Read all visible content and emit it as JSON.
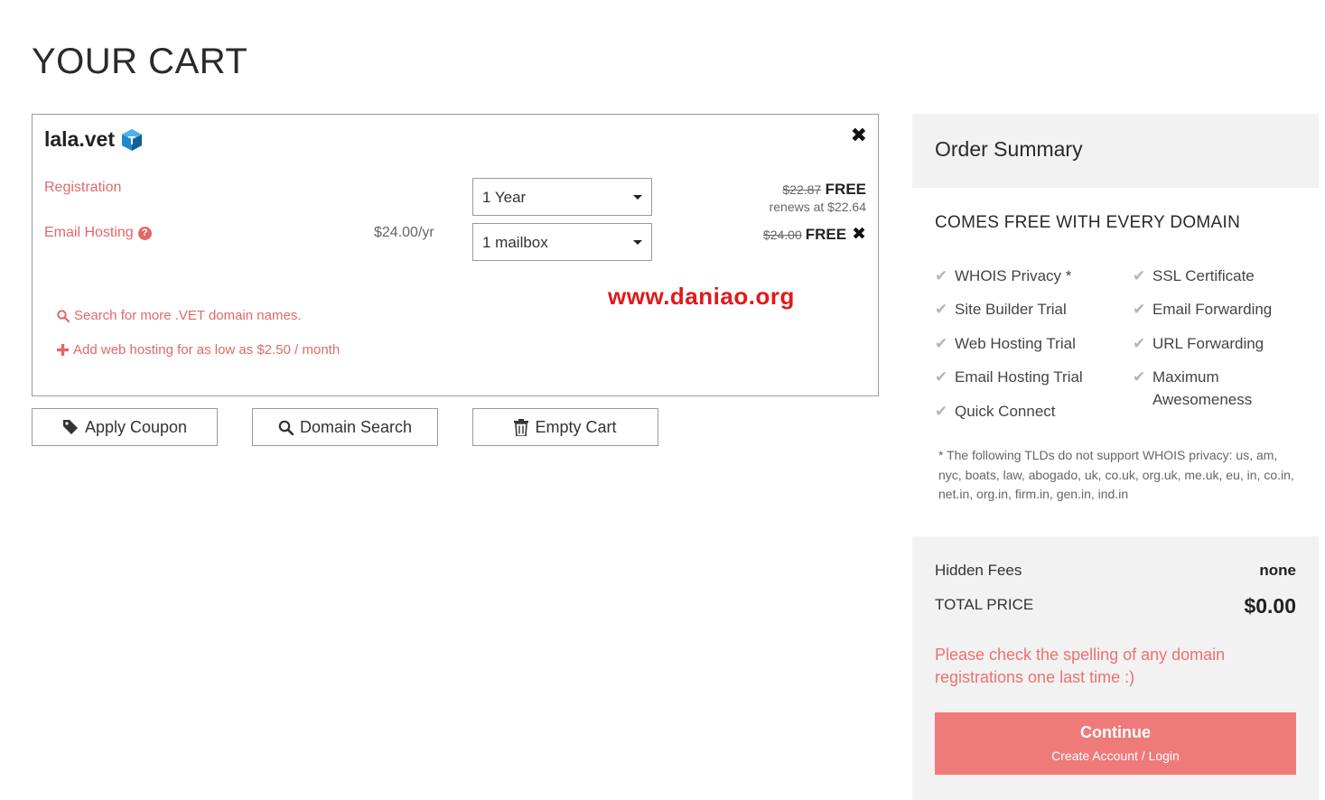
{
  "page": {
    "title": "YOUR CART"
  },
  "cart": {
    "domain": "lala.vet",
    "tld_badge": "T",
    "remove_icon": "close-icon",
    "rows": {
      "registration": {
        "label": "Registration",
        "term": "1 Year",
        "old_price": "$22.87",
        "price": "FREE",
        "renews": "renews at $22.64"
      },
      "email": {
        "label": "Email Hosting",
        "help": "?",
        "list_price": "$24.00/yr",
        "term": "1 mailbox",
        "old_price": "$24.00",
        "price": "FREE"
      }
    },
    "watermark": "www.daniao.org",
    "links": {
      "search": "Search for more .VET domain names.",
      "hosting": "Add web hosting for as low as $2.50 / month"
    }
  },
  "actions": {
    "coupon": "Apply Coupon",
    "search": "Domain Search",
    "empty": "Empty Cart"
  },
  "summary": {
    "title": "Order Summary",
    "free_title": "COMES FREE WITH EVERY DOMAIN",
    "features_left": [
      "WHOIS Privacy *",
      "Site Builder Trial",
      "Web Hosting Trial",
      "Email Hosting Trial",
      "Quick Connect"
    ],
    "features_right": [
      "SSL Certificate",
      "Email Forwarding",
      "URL Forwarding",
      "Maximum Awesomeness"
    ],
    "tld_note": "* The following TLDs do not support WHOIS privacy: us, am, nyc, boats, law, abogado, uk, co.uk, org.uk, me.uk, eu, in, co.in, net.in, org.in, firm.in, gen.in, ind.in",
    "hidden_fees_label": "Hidden Fees",
    "hidden_fees_value": "none",
    "total_label": "TOTAL PRICE",
    "total_value": "$0.00",
    "spell_note": "Please check the spelling of any domain registrations one last time :)",
    "continue_label": "Continue",
    "continue_sub": "Create Account / Login"
  },
  "colors": {
    "accent": "#e26868",
    "button": "#ef7a7a",
    "panel_bg": "#f2f2f2",
    "watermark": "#e0191a"
  }
}
